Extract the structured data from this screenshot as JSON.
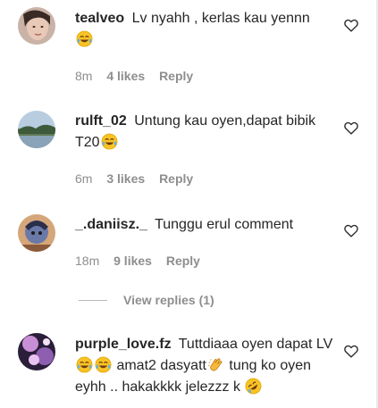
{
  "comments": [
    {
      "username": "tealveo",
      "text_before": "Lv nyahh , kerlas kau yennn",
      "text_after": "",
      "emoji": "face-with-tears-of-joy",
      "time": "8m",
      "likes": "4 likes",
      "reply": "Reply"
    },
    {
      "username": "rulft_02",
      "text_before": "Untung kau oyen,dapat bibik T20",
      "text_after": "",
      "emoji": "face-with-tears-of-joy",
      "time": "6m",
      "likes": "3 likes",
      "reply": "Reply"
    },
    {
      "username": "_.daniisz._",
      "text_before": "Tunggu erul comment",
      "time": "18m",
      "likes": "9 likes",
      "reply": "Reply"
    },
    {
      "username": "purple_love.fz",
      "text_part1": "Tuttdiaaa oyen dapat LV",
      "text_part2": "amat2 dasyatt",
      "text_part3": "tung ko oyen eyhh .. hakakkkk jelezzz k",
      "emojis": [
        "face-with-tears-of-joy",
        "face-with-tears-of-joy",
        "clapping-hands",
        "rolling-on-floor-laughing"
      ]
    }
  ],
  "view_replies": "View replies (1)",
  "icons": {
    "like": "heart-outline-icon",
    "color_meta": "#8e8e8e",
    "color_text": "#262626"
  }
}
